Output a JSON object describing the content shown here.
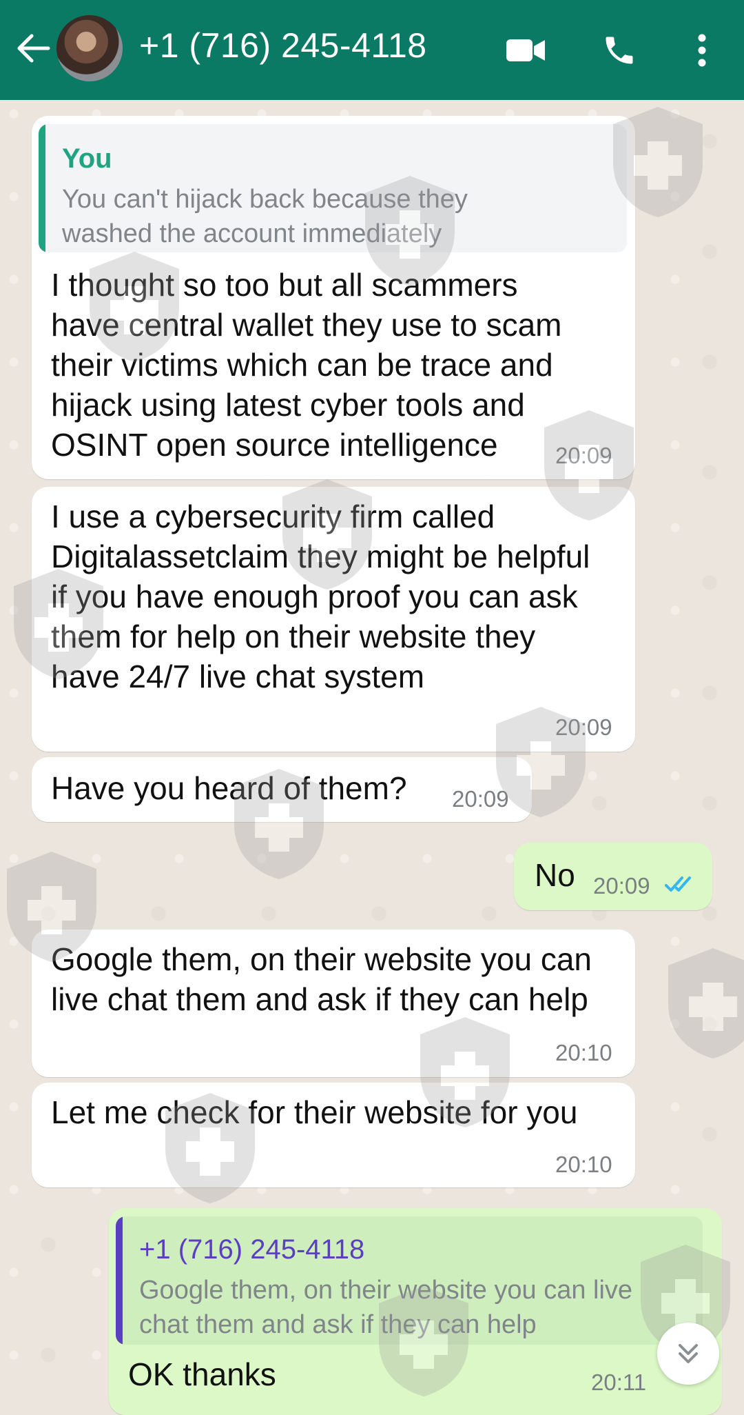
{
  "header": {
    "contact_name": "+1 (716) 245-4118",
    "icons": [
      "back-arrow-icon",
      "avatar",
      "video-call-icon",
      "voice-call-icon",
      "more-vert-icon"
    ],
    "bar_color": "#0b7a65"
  },
  "messages": [
    {
      "direction": "incoming",
      "quote_sender": "You",
      "quote_text": "You can't hijack back because they washed the account immediately",
      "text": "I thought so too but all scammers have central wallet they use to scam their victims which can be trace and hijack using latest cyber tools and OSINT open source intelligence",
      "time": "20:09"
    },
    {
      "direction": "incoming",
      "text": "I use a cybersecurity firm called Digitalassetclaim they might be helpful if you have enough proof you can ask them for help on their website they have 24/7 live chat system",
      "time": "20:09"
    },
    {
      "direction": "incoming",
      "text": "Have you heard of them?",
      "time": "20:09"
    },
    {
      "direction": "outgoing",
      "text": "No",
      "time": "20:09",
      "status": "read"
    },
    {
      "direction": "incoming",
      "text": "Google them, on their website you can live chat them and ask if they can help",
      "time": "20:10"
    },
    {
      "direction": "incoming",
      "text": "Let me check for their website for you",
      "time": "20:10"
    },
    {
      "direction": "outgoing",
      "quote_sender": "+1 (716) 245-4118",
      "quote_text": "Google them, on their website you can live chat them and ask if they can help",
      "text": "OK thanks",
      "time": "20:11"
    }
  ],
  "colors": {
    "incoming_bubble": "#ffffff",
    "outgoing_bubble": "#dcf8c6",
    "wallpaper": "#ece5dd",
    "quote_you_accent": "#1fa381",
    "quote_contact_accent": "#5a3fc0",
    "read_ticks": "#34b7f1"
  }
}
